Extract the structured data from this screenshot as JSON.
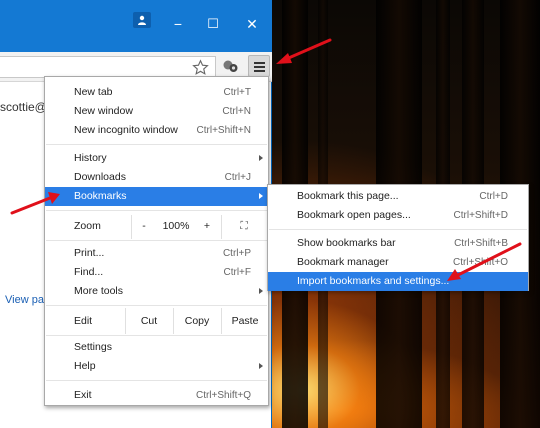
{
  "window": {
    "minimize_glyph": "−",
    "maximize_glyph": "☐",
    "close_glyph": "✕"
  },
  "page": {
    "email_fragment": "scottie@",
    "view_link_fragment": "View pa"
  },
  "menu": {
    "new_tab": {
      "label": "New tab",
      "shortcut": "Ctrl+T"
    },
    "new_window": {
      "label": "New window",
      "shortcut": "Ctrl+N"
    },
    "new_incognito": {
      "label": "New incognito window",
      "shortcut": "Ctrl+Shift+N"
    },
    "history": {
      "label": "History"
    },
    "downloads": {
      "label": "Downloads",
      "shortcut": "Ctrl+J"
    },
    "bookmarks": {
      "label": "Bookmarks"
    },
    "zoom": {
      "label": "Zoom",
      "minus": "-",
      "value": "100%",
      "plus": "+",
      "fullscreen": "⛶"
    },
    "print": {
      "label": "Print...",
      "shortcut": "Ctrl+P"
    },
    "find": {
      "label": "Find...",
      "shortcut": "Ctrl+F"
    },
    "more_tools": {
      "label": "More tools"
    },
    "edit": {
      "label": "Edit",
      "cut": "Cut",
      "copy": "Copy",
      "paste": "Paste"
    },
    "settings": {
      "label": "Settings"
    },
    "help": {
      "label": "Help"
    },
    "exit": {
      "label": "Exit",
      "shortcut": "Ctrl+Shift+Q"
    }
  },
  "bookmarks_submenu": {
    "bookmark_page": {
      "label": "Bookmark this page...",
      "shortcut": "Ctrl+D"
    },
    "bookmark_open_pages": {
      "label": "Bookmark open pages...",
      "shortcut": "Ctrl+Shift+D"
    },
    "show_bar": {
      "label": "Show bookmarks bar",
      "shortcut": "Ctrl+Shift+B"
    },
    "manager": {
      "label": "Bookmark manager",
      "shortcut": "Ctrl+Shift+O"
    },
    "import": {
      "label": "Import bookmarks and settings..."
    }
  },
  "colors": {
    "titlebar": "#1479d3",
    "highlight": "#2a7ee6",
    "annotation_arrow": "#e0101a"
  }
}
